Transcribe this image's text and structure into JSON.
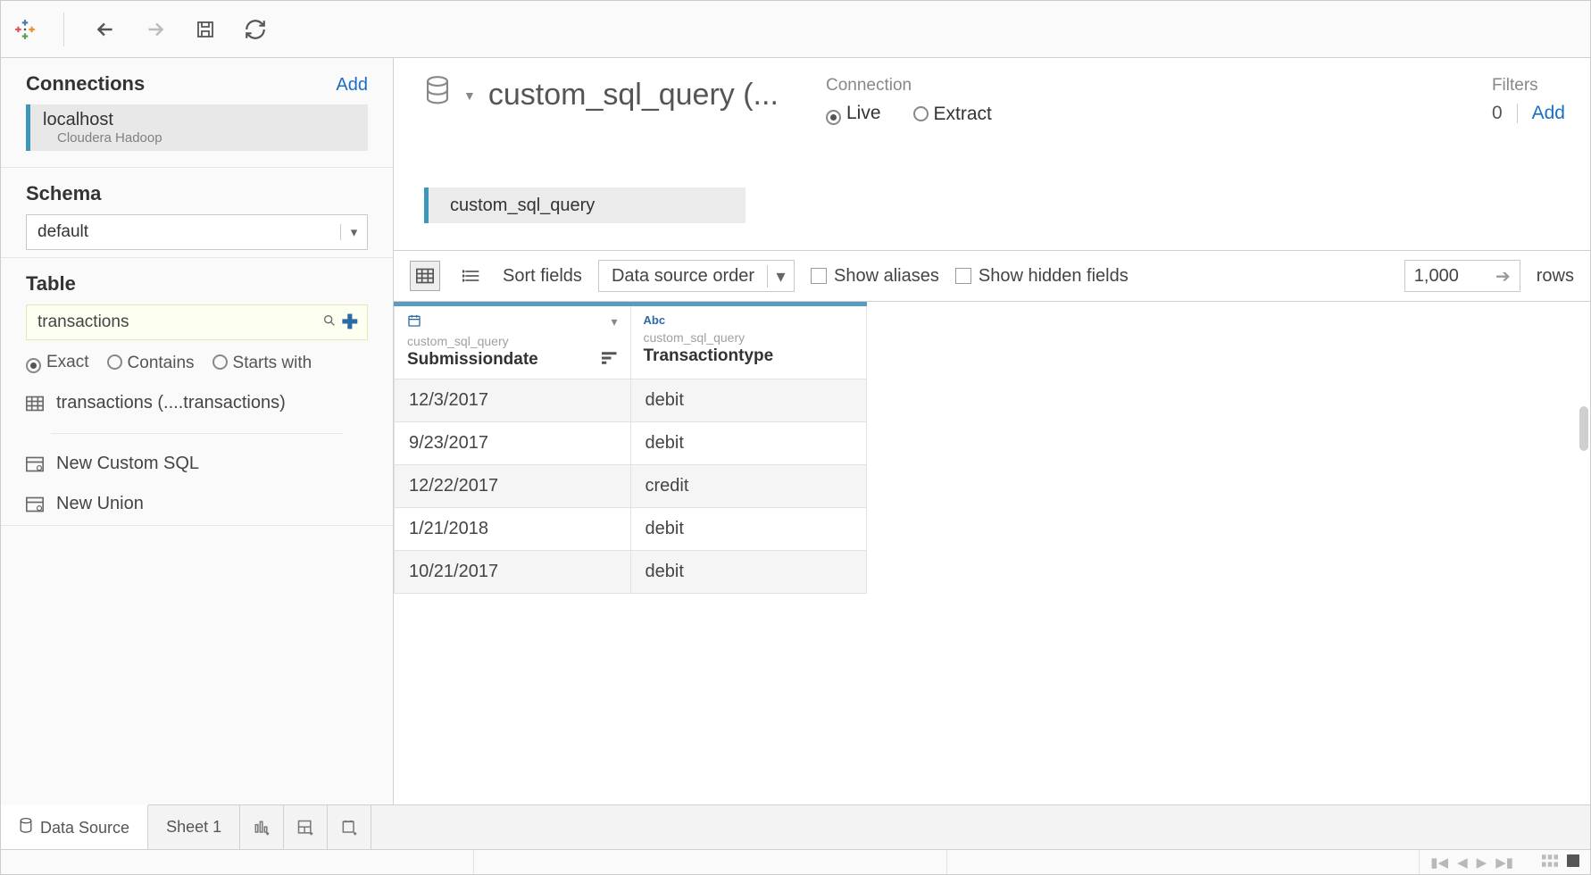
{
  "toolbar": {},
  "left": {
    "connections_label": "Connections",
    "add_label": "Add",
    "connection": {
      "name": "localhost",
      "type": "Cloudera Hadoop"
    },
    "schema_label": "Schema",
    "schema_value": "default",
    "table_label": "Table",
    "table_search": "transactions",
    "match": {
      "exact": "Exact",
      "contains": "Contains",
      "starts": "Starts with"
    },
    "tables": {
      "transactions": "transactions (....transactions)",
      "custom_sql": "New Custom SQL",
      "new_union": "New Union"
    }
  },
  "header": {
    "title": "custom_sql_query (...",
    "connection_label": "Connection",
    "live": "Live",
    "extract": "Extract",
    "filters_label": "Filters",
    "filters_count": "0",
    "filters_add": "Add"
  },
  "canvas": {
    "chip": "custom_sql_query"
  },
  "gridbar": {
    "sort_label": "Sort fields",
    "sort_value": "Data source order",
    "show_aliases": "Show aliases",
    "show_hidden": "Show hidden fields",
    "rows_value": "1,000",
    "rows_label": "rows"
  },
  "grid": {
    "columns": [
      {
        "type_label": "date",
        "source": "custom_sql_query",
        "name": "Submissiondate"
      },
      {
        "type_label": "Abc",
        "source": "custom_sql_query",
        "name": "Transactiontype"
      }
    ],
    "rows": [
      {
        "c0": "12/3/2017",
        "c1": "debit"
      },
      {
        "c0": "9/23/2017",
        "c1": "debit"
      },
      {
        "c0": "12/22/2017",
        "c1": "credit"
      },
      {
        "c0": "1/21/2018",
        "c1": "debit"
      },
      {
        "c0": "10/21/2017",
        "c1": "debit"
      }
    ]
  },
  "bottom": {
    "data_source": "Data Source",
    "sheet1": "Sheet 1"
  }
}
